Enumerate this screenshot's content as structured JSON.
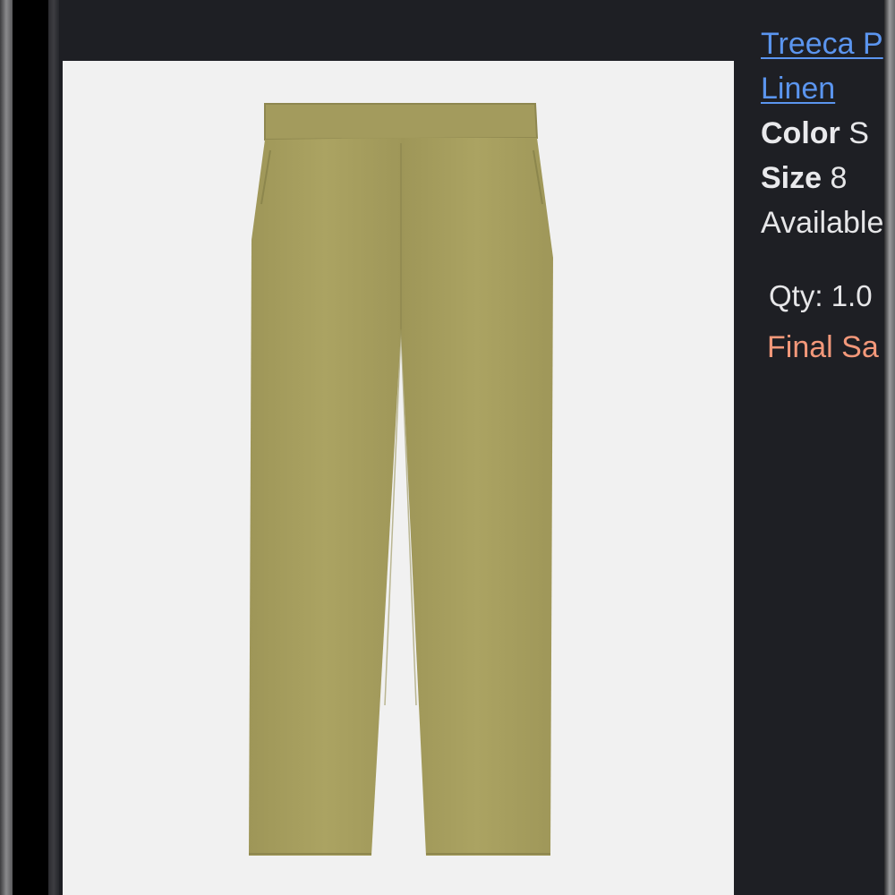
{
  "product": {
    "name_line1": "Treeca P",
    "name_line2": "Linen",
    "color_label": "Color",
    "color_value": "S",
    "size_label": "Size",
    "size_value": "8",
    "availability": "Available",
    "qty_label": "Qty:",
    "qty_value": "1.0",
    "final_sale": "Final Sa"
  },
  "image": {
    "subject": "olive linen pants",
    "background_color": "#f1f1f1",
    "garment_color": "#a8a060"
  },
  "colors": {
    "page_background": "#1e1f24",
    "link": "#5b95ef",
    "text": "#e6e6e8",
    "final_sale": "#f3987a"
  }
}
